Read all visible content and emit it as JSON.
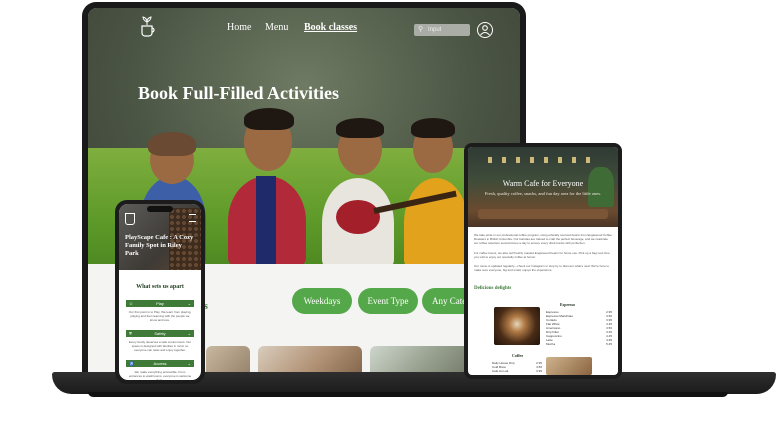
{
  "laptop": {
    "nav": {
      "links": [
        "Home",
        "Menu",
        "Book classes"
      ],
      "search_placeholder": "Input"
    },
    "hero_title": "Book Full-Filled Activities",
    "partial_label": "ts",
    "filters": [
      "Weekdays",
      "Event Type",
      "Any Categor"
    ]
  },
  "phone": {
    "hero_title": "PlayScape Cafe : A Cozy Family Spot in Riley Park",
    "subtitle": "What sets us apart",
    "sections": [
      {
        "label": "Play",
        "icon": "users-icon",
        "text": "Our first point is to Play. We learn from playing, playing and then learning with the people we know and love."
      },
      {
        "label": "Safety",
        "icon": "shield-icon",
        "text": "Every family deserves a safe environment. Our space is designed with families in mind, so everyone can relax and enjoy together."
      },
      {
        "label": "Access",
        "icon": "accessibility-icon",
        "text": "We make everything accessible. From entrances to washrooms, everyone is welcome here."
      }
    ]
  },
  "tablet": {
    "hero_title": "Warm Cafe for Everyone",
    "hero_sub": "Fresh, quality coffee, snacks, and fun day area for the little ones.",
    "paragraphs": [
      "We take pride in our professional coffee program, using ethically sourced beans from Englewood Coffee Roasters in British Columbia. Our baristas are trained to craft the perfect beverage, and we celebrate our coffee selection several times a day to ensure every drink bursts with perfection.",
      "For coffee lovers, we also sell freshly roasted Englewood beans for home use. Pick up a bag next time you visit to enjoy our specialty coffee at home!",
      "Our menu is updated regularly—check our Instagram or stop by to discover what's new! We're here to make sure everyone, big and small, enjoys the experience."
    ],
    "delights_title": "Delicious delights",
    "espresso": {
      "title": "Espresso",
      "items": [
        [
          "Espresso",
          "2.95"
        ],
        [
          "Espresso Macchiato",
          "3.50"
        ],
        [
          "Cortado",
          "3.95"
        ],
        [
          "Flat White",
          "4.45"
        ],
        [
          "Americano",
          "3.50"
        ],
        [
          "Drip Filter",
          "3.45"
        ],
        [
          "Cappuccino",
          "4.45"
        ],
        [
          "Latte",
          "4.95"
        ],
        [
          "Mocha",
          "5.45"
        ]
      ]
    },
    "coffee": {
      "title": "Coffee",
      "items": [
        [
          "Daily House Drip",
          "2.95"
        ],
        [
          "Cold Brew",
          "4.50"
        ],
        [
          "Cafe Au Lait",
          "3.95"
        ]
      ]
    }
  },
  "colors": {
    "brand_green": "#55a84a",
    "dark_green": "#3f7a39",
    "device_dark": "#1c1c1c"
  }
}
